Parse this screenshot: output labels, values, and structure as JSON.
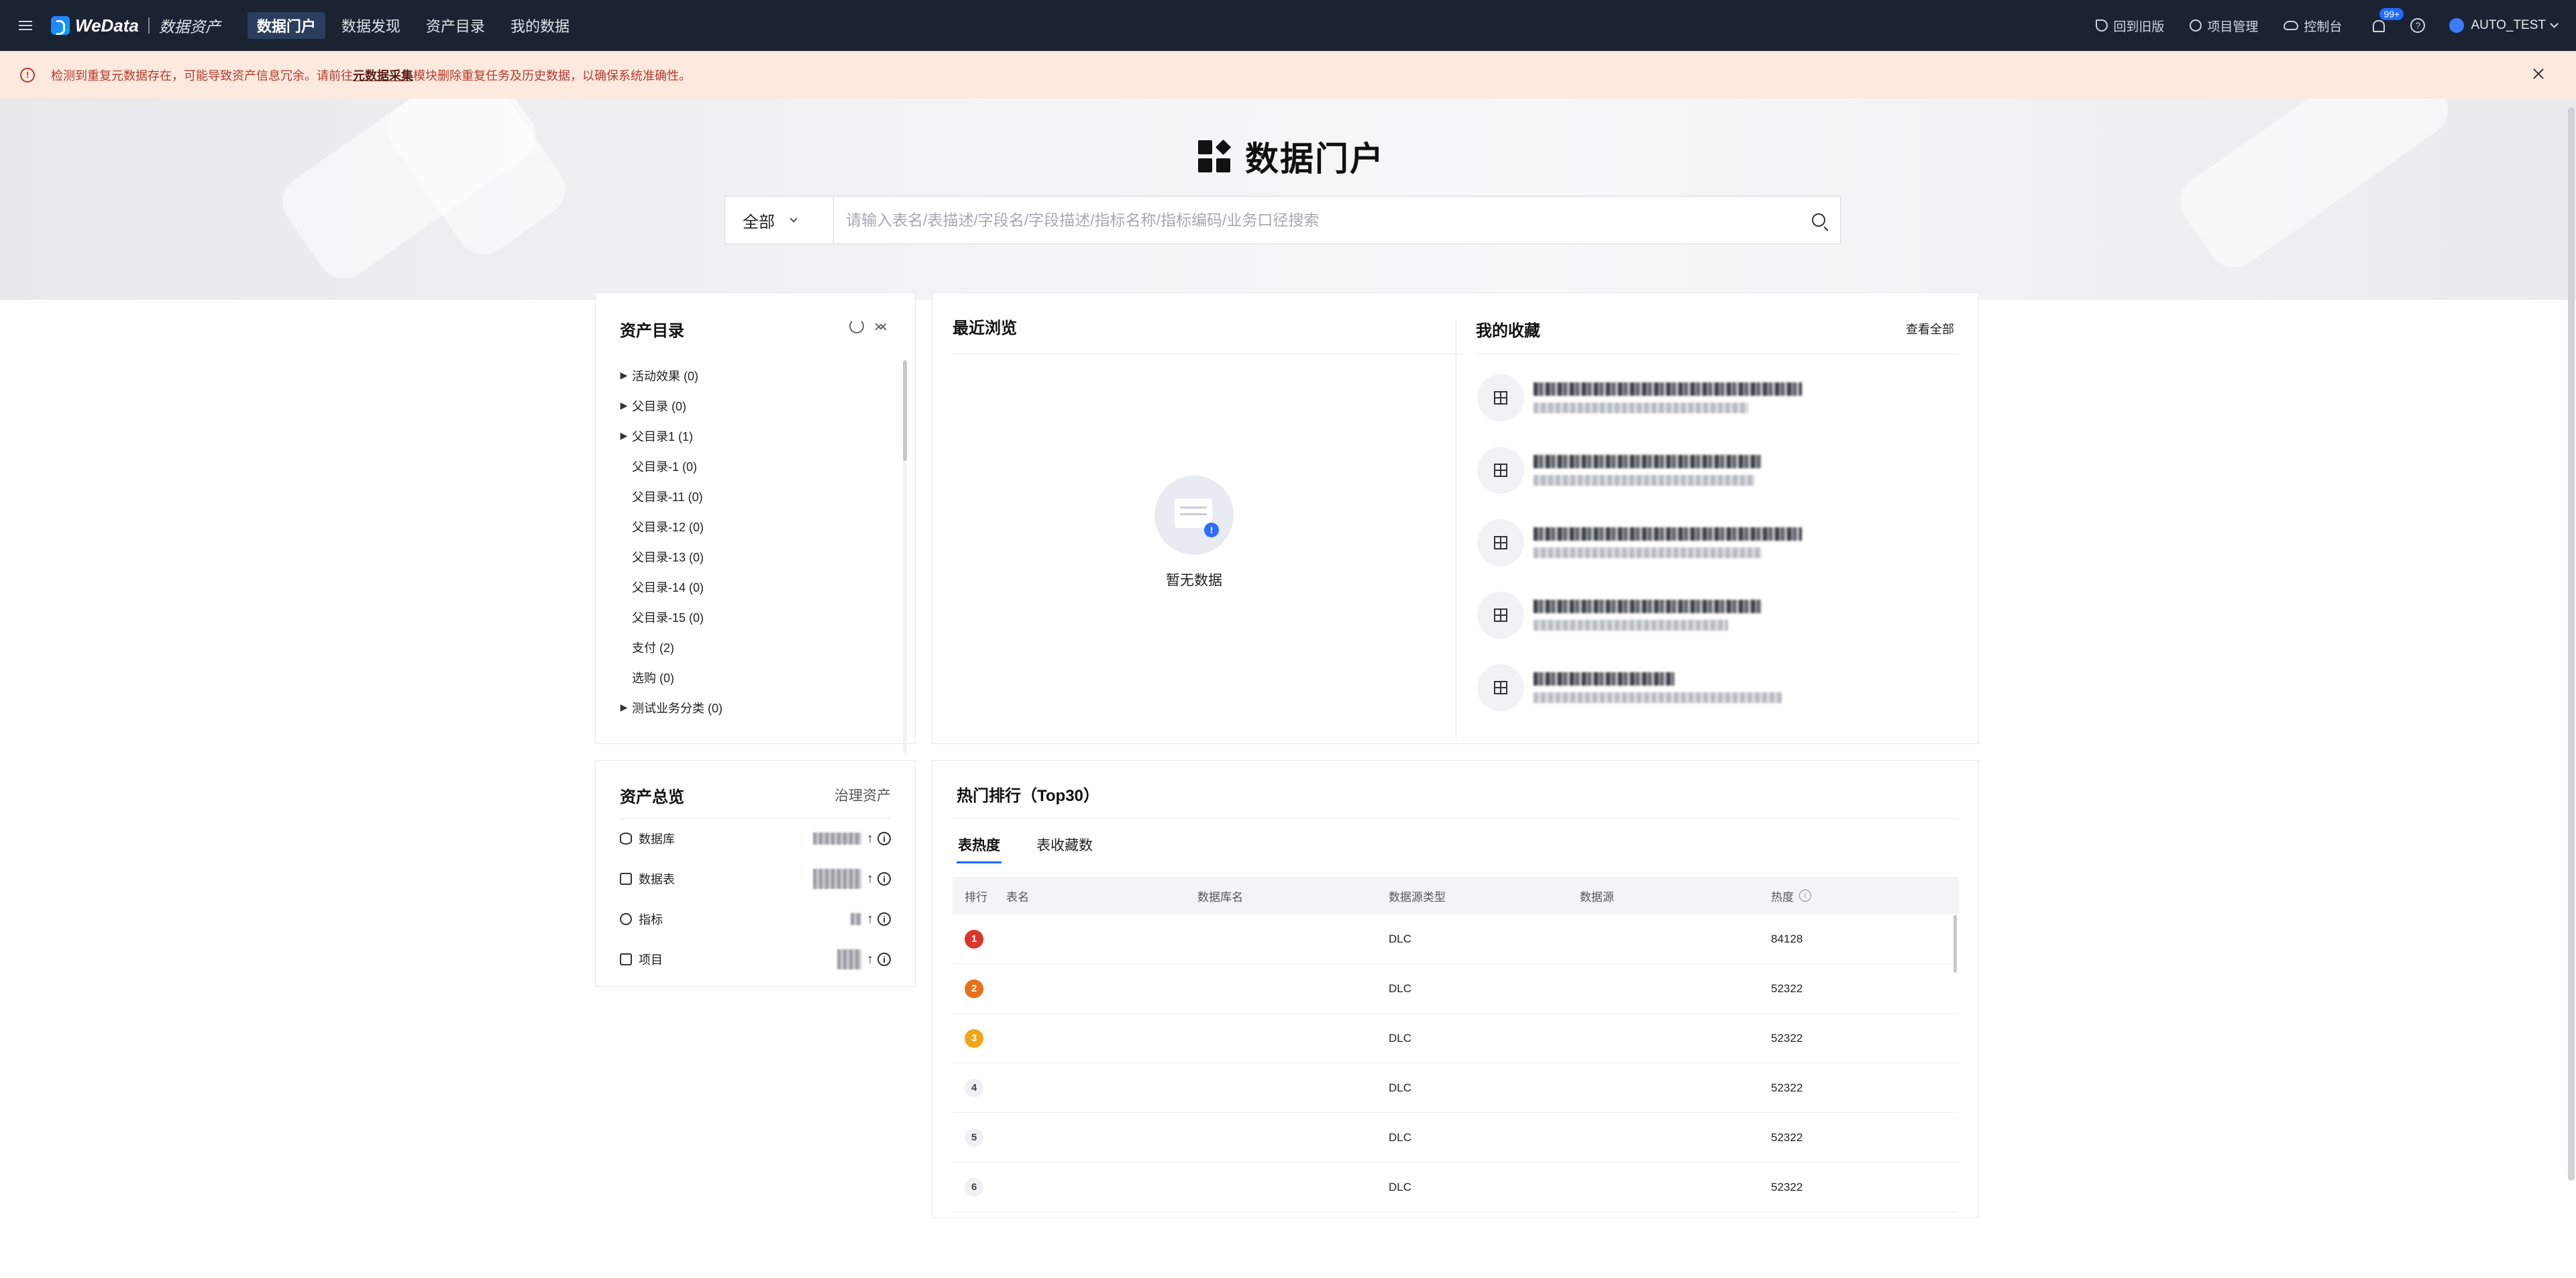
{
  "topbar": {
    "brand_name": "WeData",
    "brand_sub": "数据资产",
    "tabs": [
      {
        "label": "数据门户",
        "active": true
      },
      {
        "label": "数据发现",
        "active": false
      },
      {
        "label": "资产目录",
        "active": false
      },
      {
        "label": "我的数据",
        "active": false
      }
    ],
    "right_links": [
      {
        "label": "回到旧版",
        "icon": "undo-icon"
      },
      {
        "label": "项目管理",
        "icon": "gear-icon"
      },
      {
        "label": "控制台",
        "icon": "cloud-icon"
      }
    ],
    "notification_badge": "99+",
    "user_name": "AUTO_TEST"
  },
  "alert": {
    "text_before": "检测到重复元数据存在，可能导致资产信息冗余。请前往",
    "link_text": "元数据采集",
    "text_after": "模块删除重复任务及历史数据，以确保系统准确性。"
  },
  "hero": {
    "title": "数据门户",
    "search_scope": "全部",
    "search_placeholder": "请输入表名/表描述/字段名/字段描述/指标名称/指标编码/业务口径搜索"
  },
  "catalog": {
    "title": "资产目录",
    "items": [
      {
        "label": "活动效果 (0)",
        "expandable": true
      },
      {
        "label": "父目录 (0)",
        "expandable": true
      },
      {
        "label": "父目录1 (1)",
        "expandable": true
      },
      {
        "label": "父目录-1 (0)",
        "expandable": false
      },
      {
        "label": "父目录-11 (0)",
        "expandable": false
      },
      {
        "label": "父目录-12 (0)",
        "expandable": false
      },
      {
        "label": "父目录-13 (0)",
        "expandable": false
      },
      {
        "label": "父目录-14 (0)",
        "expandable": false
      },
      {
        "label": "父目录-15 (0)",
        "expandable": false
      },
      {
        "label": "支付 (2)",
        "expandable": false
      },
      {
        "label": "选购 (0)",
        "expandable": false
      },
      {
        "label": "测试业务分类 (0)",
        "expandable": true
      }
    ]
  },
  "overview": {
    "title": "资产总览",
    "action": "治理资产",
    "rows": [
      {
        "label": "数据库",
        "icon": "database-icon"
      },
      {
        "label": "数据表",
        "icon": "table-icon"
      },
      {
        "label": "指标",
        "icon": "metric-icon"
      },
      {
        "label": "项目",
        "icon": "folder-icon"
      }
    ]
  },
  "recent": {
    "title": "最近浏览",
    "empty_text": "暂无数据"
  },
  "favorites": {
    "title": "我的收藏",
    "action": "查看全部"
  },
  "hot": {
    "title": "热门排行（Top30）",
    "tabs": [
      {
        "label": "表热度",
        "active": true
      },
      {
        "label": "表收藏数",
        "active": false
      }
    ],
    "columns": [
      "排行",
      "表名",
      "数据库名",
      "数据源类型",
      "数据源",
      "热度"
    ],
    "rows": [
      {
        "rank": "1",
        "type": "DLC",
        "heat": "84128"
      },
      {
        "rank": "2",
        "type": "DLC",
        "heat": "52322"
      },
      {
        "rank": "3",
        "type": "DLC",
        "heat": "52322"
      },
      {
        "rank": "4",
        "type": "DLC",
        "heat": "52322"
      },
      {
        "rank": "5",
        "type": "DLC",
        "heat": "52322"
      },
      {
        "rank": "6",
        "type": "DLC",
        "heat": "52322"
      }
    ]
  },
  "colors": {
    "topbar_bg": "#1b2333",
    "alert_bg": "#fde9dd",
    "accent": "#1e6bff",
    "rank1": "#d9362b",
    "rank2": "#e8701a",
    "rank3": "#f0a51b"
  }
}
